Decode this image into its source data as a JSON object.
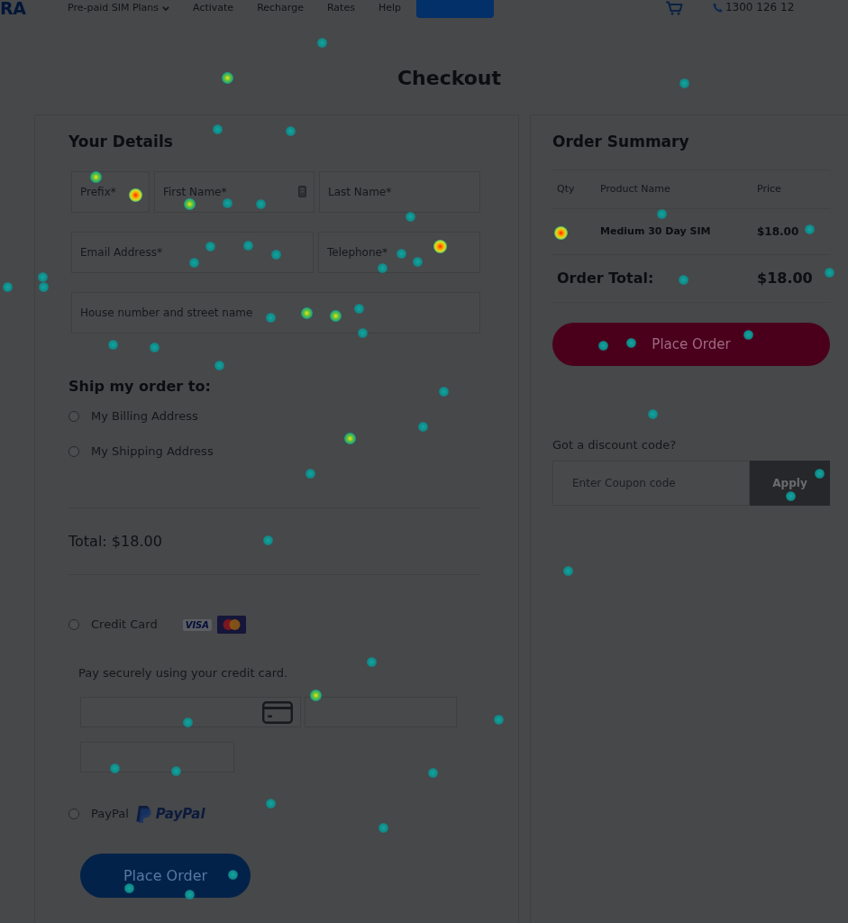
{
  "nav": {
    "logo": "RA",
    "links": [
      {
        "label": "Pre-paid SIM Plans",
        "dropdown": true
      },
      {
        "label": "Activate",
        "dropdown": false
      },
      {
        "label": "Recharge",
        "dropdown": false
      },
      {
        "label": "Rates",
        "dropdown": false
      },
      {
        "label": "Help",
        "dropdown": false
      }
    ],
    "phone": "1300 126 12"
  },
  "title": "Checkout",
  "details": {
    "title": "Your Details",
    "field_rows": [
      [
        {
          "placeholder": "Prefix*",
          "autofill_icon": false
        },
        {
          "placeholder": "First Name*",
          "autofill_icon": true
        },
        {
          "placeholder": "Last Name*",
          "autofill_icon": false
        }
      ],
      [
        {
          "placeholder": "Email Address*",
          "autofill_icon": false
        },
        {
          "placeholder": "Telephone*",
          "autofill_icon": false
        }
      ],
      [
        {
          "placeholder": "House number and street name",
          "autofill_icon": false
        }
      ]
    ]
  },
  "shipping": {
    "title": "Ship my order to:",
    "options": [
      {
        "label": "My Billing Address",
        "selected": false
      },
      {
        "label": "My Shipping Address",
        "selected": false
      }
    ]
  },
  "total": "Total: $18.00",
  "payment": {
    "methods": [
      {
        "kind": "card",
        "label": "Credit Card",
        "selected": false,
        "brands": [
          {
            "kind": "visa",
            "label": "VISA"
          },
          {
            "kind": "mastercard"
          }
        ],
        "note": "Pay securely using your credit card."
      },
      {
        "kind": "paypal",
        "label": "PayPal",
        "selected": false,
        "logo_text": "PayPal"
      }
    ],
    "button": "Place Order"
  },
  "summary": {
    "title": "Order Summary",
    "columns": [
      "Qty",
      "Product Name",
      "Price"
    ],
    "rows": [
      {
        "product": "Medium 30 Day SIM",
        "price": "$18.00"
      }
    ],
    "total_label": "Order Total:",
    "total_value": "$18.00",
    "button": "Place Order",
    "discount": {
      "label": "Got a discount code?",
      "placeholder": "Enter Coupon code",
      "button": "Apply"
    }
  }
}
